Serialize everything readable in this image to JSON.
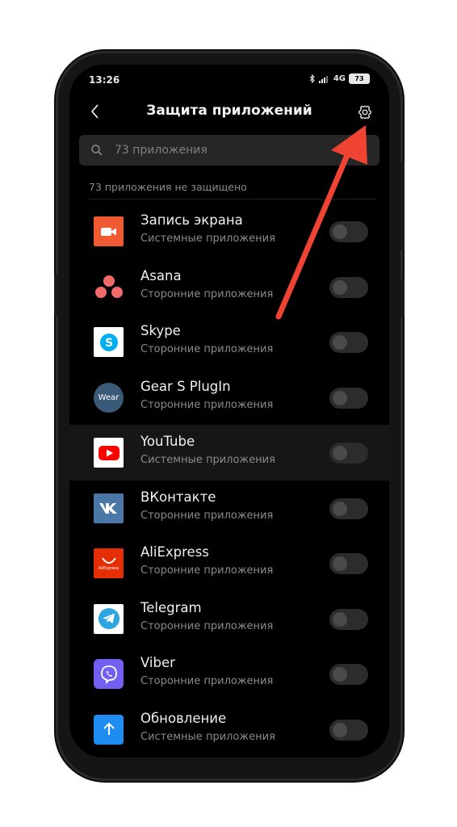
{
  "status_bar": {
    "time": "13:26",
    "network": "4G",
    "battery": "73"
  },
  "header": {
    "title": "Защита приложений"
  },
  "search": {
    "placeholder": "73 приложения"
  },
  "section": {
    "label": "73 приложения не защищено"
  },
  "colors": {
    "background": "#000000",
    "arrow": "#ef4433",
    "toggle_off": "#2c2c2c"
  },
  "apps": [
    {
      "name": "Запись экрана",
      "category": "Системные приложения",
      "icon": "screen-recorder-icon",
      "protected": false
    },
    {
      "name": "Asana",
      "category": "Сторонние приложения",
      "icon": "asana-icon",
      "protected": false
    },
    {
      "name": "Skype",
      "category": "Сторонние приложения",
      "icon": "skype-icon",
      "protected": false
    },
    {
      "name": "Gear S PlugIn",
      "category": "Сторонние приложения",
      "icon": "wear-icon",
      "icon_text": "Wear",
      "protected": false
    },
    {
      "name": "YouTube",
      "category": "Системные приложения",
      "icon": "youtube-icon",
      "protected": false
    },
    {
      "name": "ВКонтакте",
      "category": "Сторонние приложения",
      "icon": "vk-icon",
      "protected": false
    },
    {
      "name": "AliExpress",
      "category": "Сторонние приложения",
      "icon": "aliexpress-icon",
      "icon_text": "AliExpress",
      "protected": false
    },
    {
      "name": "Telegram",
      "category": "Сторонние приложения",
      "icon": "telegram-icon",
      "protected": false
    },
    {
      "name": "Viber",
      "category": "Сторонние приложения",
      "icon": "viber-icon",
      "protected": false
    },
    {
      "name": "Обновление",
      "category": "Системные приложения",
      "icon": "update-icon",
      "protected": false
    }
  ]
}
